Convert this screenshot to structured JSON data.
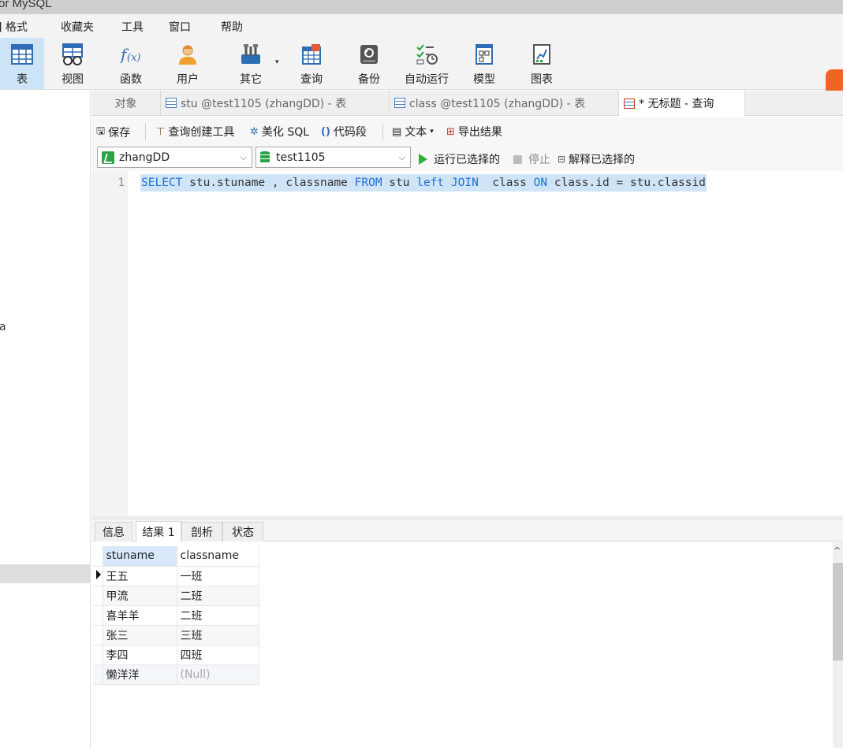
{
  "window": {
    "title": "or MySQL"
  },
  "menu": {
    "items": [
      "]  格式",
      "收藏夹",
      "工具",
      "窗口",
      "帮助"
    ]
  },
  "toolbar": {
    "items": [
      {
        "label": "表",
        "icon": "table-icon",
        "active": true
      },
      {
        "label": "视图",
        "icon": "view-icon"
      },
      {
        "label": "函数",
        "icon": "function-icon"
      },
      {
        "label": "用户",
        "icon": "user-icon"
      },
      {
        "label": "其它",
        "icon": "tools-icon"
      },
      {
        "label": "查询",
        "icon": "query-icon"
      },
      {
        "label": "备份",
        "icon": "backup-icon"
      },
      {
        "label": "自动运行",
        "icon": "autorun-icon"
      },
      {
        "label": "模型",
        "icon": "model-icon"
      },
      {
        "label": "图表",
        "icon": "chart-icon"
      }
    ],
    "caret": "▾"
  },
  "leftnav": {
    "fragment": "a"
  },
  "tabs": {
    "objects": "对象",
    "tab1": "stu @test1105 (zhangDD) - 表",
    "tab2": "class @test1105 (zhangDD) - 表",
    "tab3": "* 无标题 - 查询"
  },
  "query_toolbar": {
    "save": "保存",
    "builder": "查询创建工具",
    "beautify": "美化 SQL",
    "snippet": "代码段",
    "text": "文本",
    "text_caret": "▾",
    "export": "导出结果"
  },
  "connection": {
    "conn_name": "zhangDD",
    "db_name": "test1105",
    "run_selected": "运行已选择的",
    "stop": "停止",
    "explain_selected": "解释已选择的"
  },
  "editor": {
    "line_no": "1",
    "sql_tokens": [
      {
        "t": "SELECT",
        "kw": true
      },
      {
        "t": " stu.stuname , classname ",
        "kw": false
      },
      {
        "t": "FROM",
        "kw": true
      },
      {
        "t": " stu ",
        "kw": false
      },
      {
        "t": "left",
        "kw": true
      },
      {
        "t": " ",
        "kw": false
      },
      {
        "t": "JOIN",
        "kw": true
      },
      {
        "t": "  class ",
        "kw": false
      },
      {
        "t": "ON",
        "kw": true
      },
      {
        "t": " class.id = stu.classid",
        "kw": false
      }
    ]
  },
  "result_tabs": {
    "info": "信息",
    "result1": "结果 1",
    "profile": "剖析",
    "status": "状态"
  },
  "result": {
    "columns": [
      "stuname",
      "classname"
    ],
    "rows": [
      [
        "王五",
        "一班"
      ],
      [
        "甲流",
        "二班"
      ],
      [
        "喜羊羊",
        "二班"
      ],
      [
        "张三",
        "三班"
      ],
      [
        "李四",
        "四班"
      ],
      [
        "懒洋洋",
        "(Null)"
      ]
    ]
  },
  "scroll": {
    "up": "^"
  },
  "colors": {
    "keyword": "#1f6fd9",
    "selection": "#cfe4f7",
    "active_tool": "#cde4f7",
    "run_green": "#2bb13c"
  }
}
